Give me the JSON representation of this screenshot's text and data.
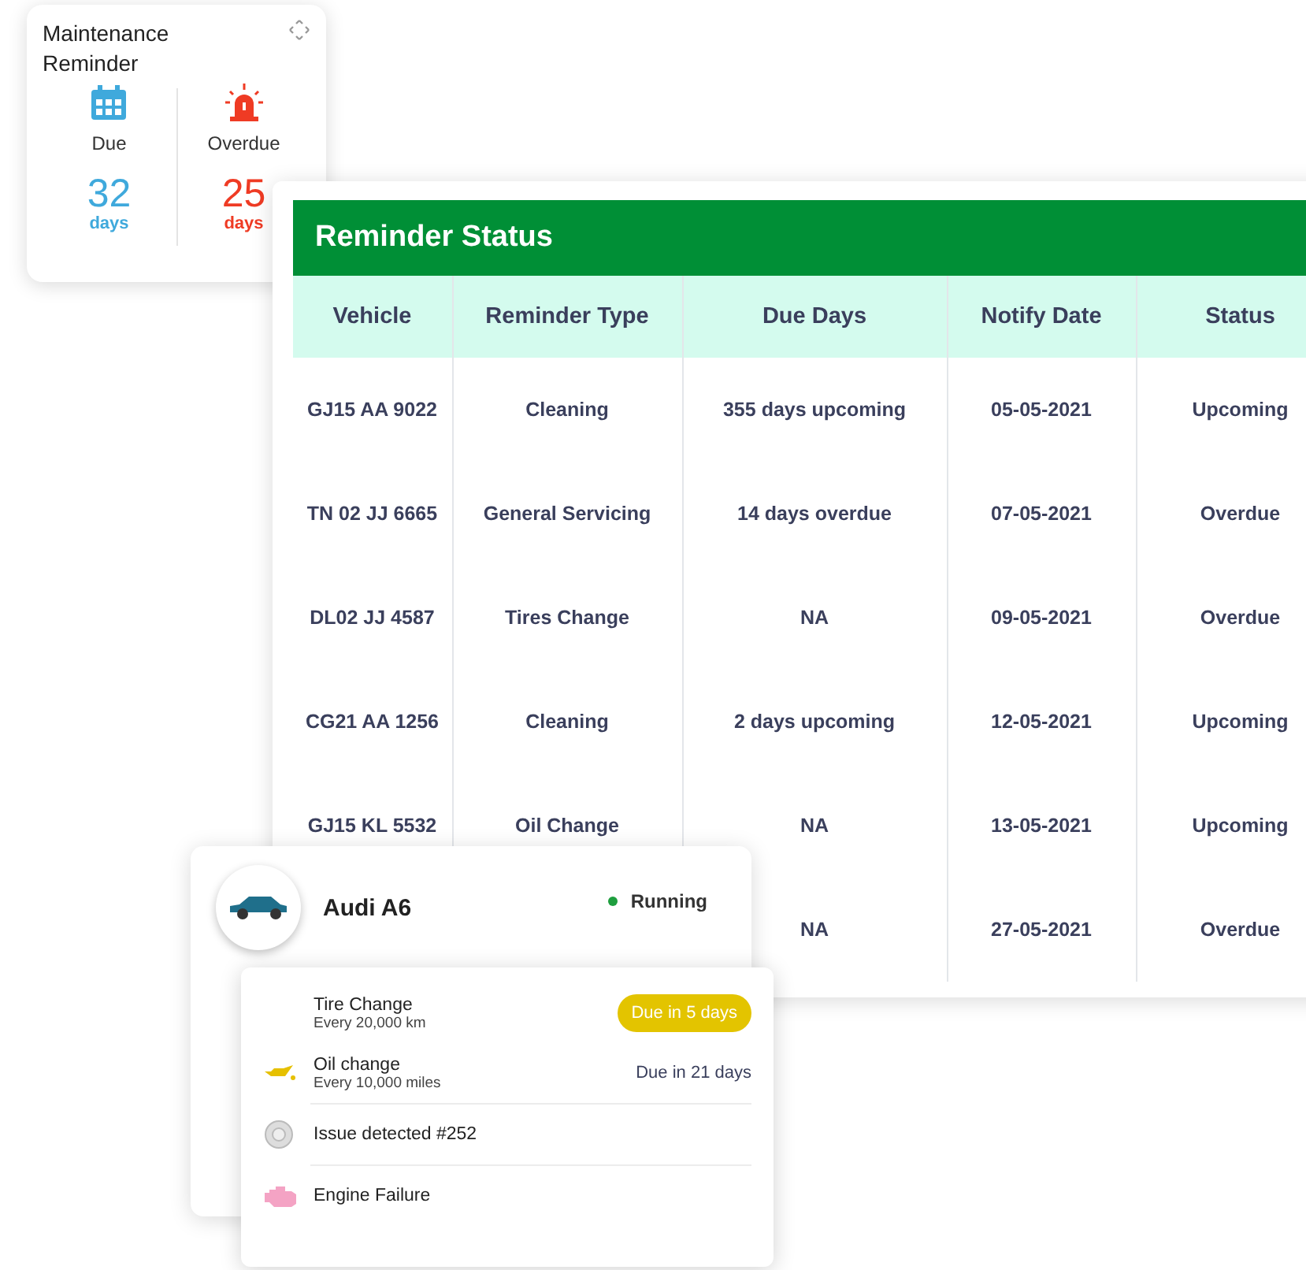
{
  "maintenance_card": {
    "title": "Maintenance Reminder",
    "due": {
      "label": "Due",
      "value": "32",
      "unit": "days"
    },
    "overdue": {
      "label": "Overdue",
      "value": "25",
      "unit": "days"
    }
  },
  "reminder_status": {
    "title": "Reminder Status",
    "columns": [
      "Vehicle",
      "Reminder Type",
      "Due Days",
      "Notify Date",
      "Status"
    ],
    "rows": [
      {
        "vehicle": "GJ15 AA 9022",
        "type": "Cleaning",
        "due_days": "355 days upcoming",
        "notify_date": "05-05-2021",
        "status": "Upcoming"
      },
      {
        "vehicle": "TN 02 JJ 6665",
        "type": "General Servicing",
        "due_days": "14 days overdue",
        "notify_date": "07-05-2021",
        "status": "Overdue"
      },
      {
        "vehicle": "DL02 JJ 4587",
        "type": "Tires Change",
        "due_days": "NA",
        "notify_date": "09-05-2021",
        "status": "Overdue"
      },
      {
        "vehicle": "CG21 AA 1256",
        "type": "Cleaning",
        "due_days": "2 days upcoming",
        "notify_date": "12-05-2021",
        "status": "Upcoming"
      },
      {
        "vehicle": "GJ15 KL 5532",
        "type": "Oil Change",
        "due_days": "NA",
        "notify_date": "13-05-2021",
        "status": "Upcoming"
      },
      {
        "due_days": "NA",
        "notify_date": "27-05-2021",
        "status": "Overdue"
      }
    ]
  },
  "vehicle_card": {
    "name": "Audi A6",
    "status": "Running",
    "items": [
      {
        "kind": "plain",
        "title": "Tire Change",
        "subtitle": "Every 20,000 km",
        "due": "Due in 5 days",
        "highlighted": true
      },
      {
        "kind": "oil",
        "title": "Oil change",
        "subtitle": "Every 10,000 miles",
        "due": "Due in 21 days",
        "highlighted": false
      },
      {
        "kind": "wheel",
        "title": "Issue detected #252"
      },
      {
        "kind": "engine",
        "title": "Engine Failure"
      }
    ]
  }
}
